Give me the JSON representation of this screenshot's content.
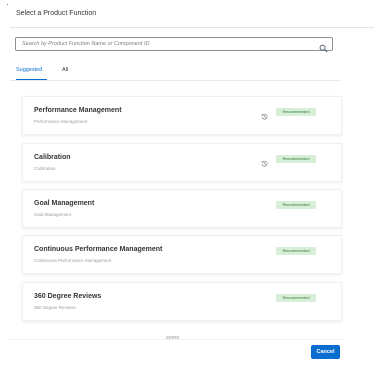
{
  "dialog": {
    "title": "Select a Product Function"
  },
  "search": {
    "placeholder": "Search by Product Function Name or Component ID",
    "value": "",
    "icon": "search-icon"
  },
  "tabs": [
    {
      "label": "Suggested",
      "selected": true
    },
    {
      "label": "All",
      "selected": false
    }
  ],
  "colors": {
    "accent": "#0a6ed1",
    "badge_bg": "#d8eed8",
    "badge_text": "#2b7d2b"
  },
  "items": [
    {
      "title": "Performance Management",
      "subtitle": "Performance Management",
      "badge": "Recommended",
      "history_icon": true
    },
    {
      "title": "Calibration",
      "subtitle": "Calibration",
      "badge": "Recommended",
      "history_icon": true
    },
    {
      "title": "Goal Management",
      "subtitle": "Goal Management",
      "badge": "Recommended",
      "history_icon": false
    },
    {
      "title": "Continuous Performance Management",
      "subtitle": "Continuous Performance Management",
      "badge": "Recommended",
      "history_icon": false
    },
    {
      "title": "360 Degree Reviews",
      "subtitle": "360 Degree Reviews",
      "badge": "Recommended",
      "history_icon": false
    }
  ],
  "more_label": "MORE",
  "footer": {
    "cancel_label": "Cancel"
  }
}
